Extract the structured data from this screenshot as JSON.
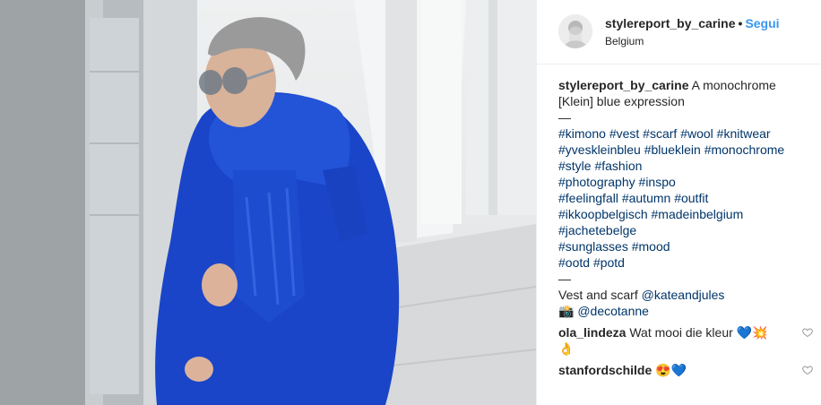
{
  "post": {
    "username": "stylereport_by_carine",
    "separator": "•",
    "follow_label": "Segui",
    "location": "Belgium"
  },
  "caption": {
    "username": "stylereport_by_carine",
    "text_line1": "A monochrome",
    "text_line2": "[Klein] blue expression",
    "dash": "—",
    "hashtag_lines": [
      [
        "#kimono",
        "#vest",
        "#scarf",
        "#wool",
        "#knitwear"
      ],
      [
        "#yveskleinbleu",
        "#blueklein",
        "#monochrome"
      ],
      [
        "#style",
        "#fashion"
      ],
      [
        "#photography",
        "#inspo"
      ],
      [
        "#feelingfall",
        "#autumn",
        "#outfit"
      ],
      [
        "#ikkoopbelgisch",
        "#madeinbelgium"
      ],
      [
        "#jachetebelge"
      ],
      [
        "#sunglasses",
        "#mood"
      ],
      [
        "#ootd",
        "#potd"
      ]
    ],
    "dash2": "—",
    "credit_text": "Vest and scarf",
    "credit_mention": "@kateandjules",
    "camera_emoji": "📸",
    "photo_mention": "@decotanne"
  },
  "comments": [
    {
      "user": "ola_lindeza",
      "text": "Wat mooi die kleur",
      "emojis": "💙💥",
      "emojis_line2": "👌"
    },
    {
      "user": "stanfordschilde",
      "text": "",
      "emojis": "😍💙"
    }
  ],
  "icons": {
    "avatar": "avatar",
    "like": "heart-outline-icon"
  },
  "colors": {
    "link": "#003569",
    "follow": "#3897f0",
    "coat": "#1a45c8"
  }
}
